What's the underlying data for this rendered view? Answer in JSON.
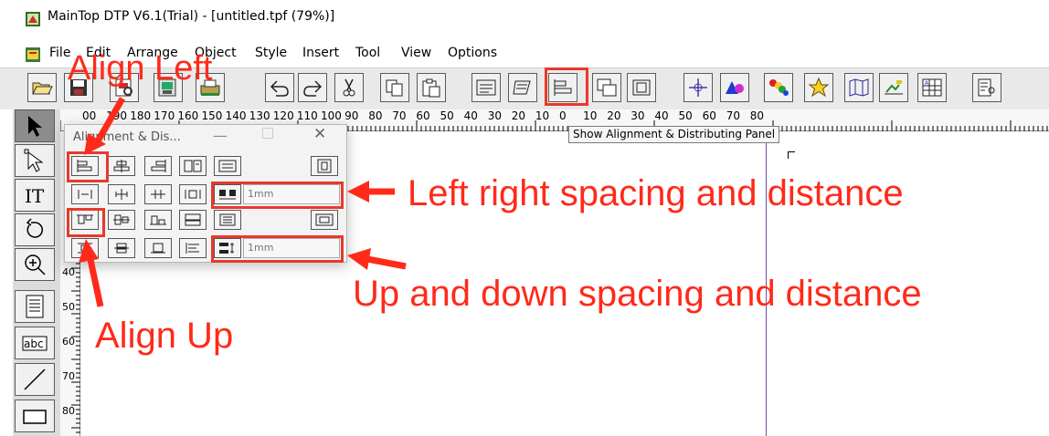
{
  "window": {
    "title": "MainTop DTP V6.1(Trial) - [untitled.tpf (79%)]"
  },
  "menu": [
    "File",
    "Edit",
    "Arrange",
    "Object",
    "Style",
    "Insert",
    "Tool",
    "View",
    "Options"
  ],
  "toolbar": {
    "tooltip": "Show Alignment & Distributing Panel",
    "buttons": [
      "open-icon",
      "save-icon",
      "print-preview-icon",
      "image-icon",
      "printer-icon",
      "undo-icon",
      "redo-icon",
      "cut-icon",
      "copy-icon",
      "paste-icon",
      "text-frame-icon",
      "text-flow-icon",
      "alignment-panel-icon",
      "arrange-icon",
      "group-icon",
      "move-icon",
      "shapes-icon",
      "color-icon",
      "star-icon",
      "map-icon",
      "image-edit-icon",
      "table-icon",
      "zoom-text-icon"
    ]
  },
  "tools": [
    "pointer-icon",
    "node-select-icon",
    "text-tool-icon",
    "rotate-icon",
    "zoom-icon",
    "page-icon",
    "abc-text-icon",
    "line-icon",
    "rectangle-icon"
  ],
  "ruler": {
    "h_labels": [
      "00",
      "190",
      "180",
      "170",
      "160",
      "150",
      "140",
      "130",
      "120",
      "110",
      "100",
      "90",
      "80",
      "70",
      "60",
      "50",
      "40",
      "30",
      "20",
      "10",
      "0",
      "10",
      "20",
      "30",
      "40",
      "50",
      "60",
      "70",
      "80"
    ],
    "v_labels": [
      "40",
      "50",
      "60",
      "70",
      "80"
    ]
  },
  "panel": {
    "title": "Alignment & Dis...",
    "spacing_lr": "1mm",
    "spacing_ud": "1mm"
  },
  "annotations": {
    "align_left": "Align Left",
    "left_right": "Left right spacing and distance",
    "up_down": "Up and down spacing and distance",
    "align_up": "Align Up",
    "color": "#ff2a1a"
  }
}
